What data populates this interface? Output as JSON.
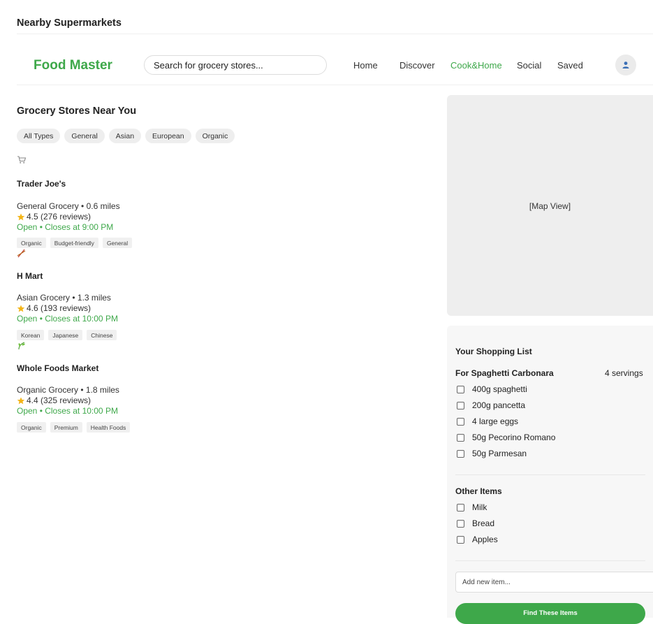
{
  "page": {
    "title": "Nearby Supermarkets"
  },
  "header": {
    "logo": "Food Master",
    "search_placeholder": "Search for grocery stores...",
    "nav": [
      "Home",
      "Discover",
      "Cook&Home",
      "Social",
      "Saved"
    ],
    "active_nav": "Cook&Home",
    "accent_color": "#3ea84a",
    "avatar_icon": "user-icon"
  },
  "stores_section": {
    "title": "Grocery Stores Near You",
    "filters": [
      "All Types",
      "General",
      "Asian",
      "European",
      "Organic"
    ],
    "stores": [
      {
        "icon": "shopping-cart-icon",
        "name": "Trader Joe's",
        "info": "General Grocery • 0.6 miles",
        "rating": "4.5 (276 reviews)",
        "hours": "Open • Closes at 9:00 PM",
        "tags": [
          "Organic",
          "Budget-friendly",
          "General"
        ]
      },
      {
        "icon": "chopsticks-icon",
        "name": "H Mart",
        "info": "Asian Grocery • 1.3 miles",
        "rating": "4.6 (193 reviews)",
        "hours": "Open • Closes at 10:00 PM",
        "tags": [
          "Korean",
          "Japanese",
          "Chinese"
        ]
      },
      {
        "icon": "herb-icon",
        "name": "Whole Foods Market",
        "info": "Organic Grocery • 1.8 miles",
        "rating": "4.4 (325 reviews)",
        "hours": "Open • Closes at 10:00 PM",
        "tags": [
          "Organic",
          "Premium",
          "Health Foods"
        ]
      }
    ]
  },
  "map": {
    "label": "[Map View]"
  },
  "shopping_list": {
    "title": "Your Shopping List",
    "recipe": "For Spaghetti Carbonara",
    "servings": "4 servings",
    "recipe_items": [
      "400g spaghetti",
      "200g pancetta",
      "4 large eggs",
      "50g Pecorino Romano",
      "50g Parmesan"
    ],
    "other_title": "Other Items",
    "other_items": [
      "Milk",
      "Bread",
      "Apples"
    ],
    "add_placeholder": "Add new item...",
    "find_button": "Find These Items"
  }
}
